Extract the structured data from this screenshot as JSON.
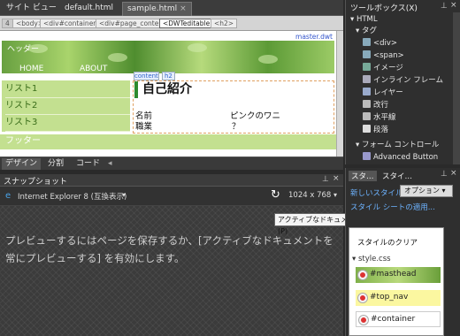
{
  "doc_tabs": [
    {
      "label": "サイト ビュー"
    },
    {
      "label": "default.html"
    },
    {
      "label": "sample.html",
      "close": "×"
    }
  ],
  "breadcrumbs": [
    "<body>",
    "<div#container>",
    "<div#page_content>",
    "<DWTeditable>",
    "<h2>"
  ],
  "breadcrumb_prefix": "4",
  "canvas": {
    "master_tag": "master.dwt",
    "header_label": "ヘッダー",
    "nav": [
      "HOME",
      "ABOUT"
    ],
    "sidebar": [
      "リスト1",
      "リスト2",
      "リスト3"
    ],
    "content_tag": "content",
    "h2_tag": "h2",
    "heading": "自己紹介",
    "rows": [
      {
        "label": "名前",
        "value": "ピンクのワニ"
      },
      {
        "label": "職業",
        "value": "？"
      }
    ],
    "footer": "フッター"
  },
  "view_tabs": [
    "デザイン",
    "分割",
    "コード"
  ],
  "snapshot": {
    "title": "スナップショット",
    "browser": "Internet Explorer 8 (互換表示)",
    "size": "1024 x 768",
    "tooltip": "アクティブなドキュメントを常にプレビューする (P)",
    "message": "プレビューするにはページを保存するか、[アクティブなドキュメントを常にプレビューする] を有効にします。"
  },
  "toolbox": {
    "title": "ツールボックス(X)",
    "sections": [
      {
        "label": "HTML"
      },
      {
        "label": "タグ"
      }
    ],
    "items": [
      {
        "label": "<div>",
        "icon": "div-icon",
        "color": "#8ab"
      },
      {
        "label": "<span>",
        "icon": "span-icon",
        "color": "#8ab"
      },
      {
        "label": "イメージ",
        "icon": "image-icon",
        "color": "#7a9"
      },
      {
        "label": "インライン フレーム",
        "icon": "iframe-icon",
        "color": "#aab"
      },
      {
        "label": "レイヤー",
        "icon": "layer-icon",
        "color": "#9ac"
      },
      {
        "label": "改行",
        "icon": "break-icon",
        "color": "#bbb"
      },
      {
        "label": "水平線",
        "icon": "hr-icon",
        "color": "#bbb"
      },
      {
        "label": "段落",
        "icon": "paragraph-icon",
        "color": "#ddd"
      }
    ],
    "form_section": "フォーム コントロール",
    "form_items": [
      {
        "label": "Advanced Button",
        "icon": "button-icon",
        "color": "#99c"
      }
    ]
  },
  "styles_panel": {
    "tabs": [
      "スタ…",
      "スタイ…"
    ],
    "new_style": "新しいスタイル...",
    "options": "オプション",
    "attach": "スタイル シートの適用...",
    "clear": "スタイルのクリア",
    "stylesheet": "style.css",
    "items": [
      "#masthead",
      "#top_nav",
      "#container"
    ]
  }
}
